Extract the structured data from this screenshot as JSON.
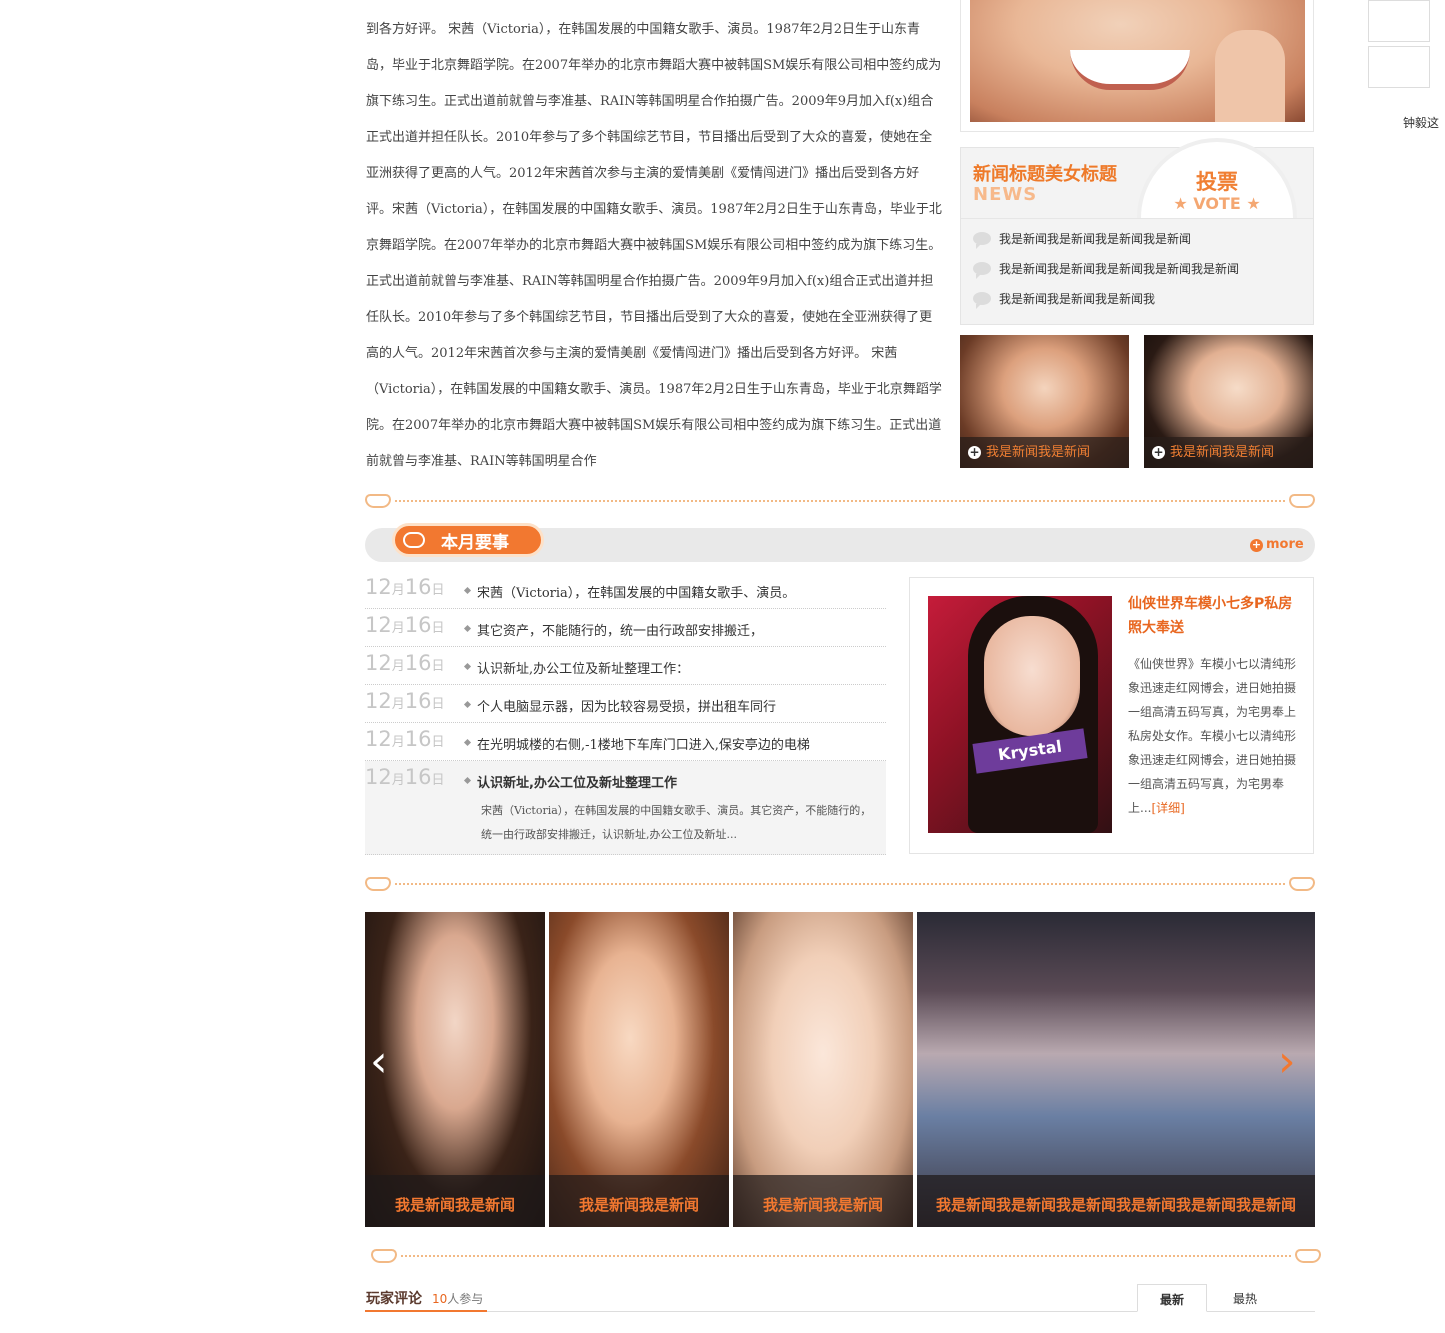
{
  "article": {
    "body": "到各方好评。 宋茜（Victoria），在韩国发展的中国籍女歌手、演员。1987年2月2日生于山东青岛，毕业于北京舞蹈学院。在2007年举办的北京市舞蹈大赛中被韩国SM娱乐有限公司相中签约成为旗下练习生。正式出道前就曾与李准基、RAIN等韩国明星合作拍摄广告。2009年9月加入f(x)组合正式出道并担任队长。2010年参与了多个韩国综艺节目，节目播出后受到了大众的喜爱，使她在全亚洲获得了更高的人气。2012年宋茜首次参与主演的爱情美剧《爱情闯进门》播出后受到各方好评。宋茜（Victoria），在韩国发展的中国籍女歌手、演员。1987年2月2日生于山东青岛，毕业于北京舞蹈学院。在2007年举办的北京市舞蹈大赛中被韩国SM娱乐有限公司相中签约成为旗下练习生。正式出道前就曾与李准基、RAIN等韩国明星合作拍摄广告。2009年9月加入f(x)组合正式出道并担任队长。2010年参与了多个韩国综艺节目，节目播出后受到了大众的喜爱，使她在全亚洲获得了更高的人气。2012年宋茜首次参与主演的爱情美剧《爱情闯进门》播出后受到各方好评。 宋茜（Victoria），在韩国发展的中国籍女歌手、演员。1987年2月2日生于山东青岛，毕业于北京舞蹈学院。在2007年举办的北京市舞蹈大赛中被韩国SM娱乐有限公司相中签约成为旗下练习生。正式出道前就曾与李准基、RAIN等韩国明星合作"
  },
  "vote": {
    "title": "新闻标题美女标题",
    "subtitle": "NEWS",
    "badge_cn": "投票",
    "badge_en": "★ VOTE ★",
    "items": [
      "我是新闻我是新闻我是新闻我是新闻",
      "我是新闻我是新闻我是新闻我是新闻我是新闻",
      "我是新闻我是新闻我是新闻我"
    ]
  },
  "thumbs": [
    "我是新闻我是新闻",
    "我是新闻我是新闻"
  ],
  "section": {
    "title": "本月要事",
    "more": "more"
  },
  "events": [
    {
      "day": "12",
      "month_unit": "月",
      "date": "16",
      "date_unit": "日",
      "text": "宋茜（Victoria），在韩国发展的中国籍女歌手、演员。"
    },
    {
      "day": "12",
      "month_unit": "月",
      "date": "16",
      "date_unit": "日",
      "text": "其它资产，不能随行的，统一由行政部安排搬迁，"
    },
    {
      "day": "12",
      "month_unit": "月",
      "date": "16",
      "date_unit": "日",
      "text": "认识新址,办公工位及新址整理工作："
    },
    {
      "day": "12",
      "month_unit": "月",
      "date": "16",
      "date_unit": "日",
      "text": "个人电脑显示器，因为比较容易受损，拼出租车同行"
    },
    {
      "day": "12",
      "month_unit": "月",
      "date": "16",
      "date_unit": "日",
      "text": "在光明城楼的右侧,-1楼地下车库门口进入,保安亭边的电梯"
    },
    {
      "day": "12",
      "month_unit": "月",
      "date": "16",
      "date_unit": "日",
      "text": "认识新址,办公工位及新址整理工作",
      "desc": "宋茜（Victoria），在韩国发展的中国籍女歌手、演员。其它资产，不能随行的，统一由行政部安排搬迁，认识新址,办公工位及新址..."
    }
  ],
  "feature": {
    "photo_text": "Krystal",
    "title": "仙侠世界车模小七多P私房照大奉送",
    "body": "《仙侠世界》车模小七以清纯形象迅速走红网博会，进日她拍摄一组高清五码写真，为宅男奉上私房处女作。车模小七以清纯形象迅速走红网博会，进日她拍摄一组高清五码写真，为宅男奉上...",
    "link": "[详细]"
  },
  "strip": [
    "我是新闻我是新闻",
    "我是新闻我是新闻",
    "我是新闻我是新闻",
    "我是新闻我是新闻我是新闻我是新闻我是新闻我是新闻"
  ],
  "nav": {
    "prev": "‹",
    "next": "›"
  },
  "comments": {
    "title": "玩家评论",
    "count": "10",
    "count_suffix": "人参与",
    "tab_new": "最新",
    "tab_hot": "最热"
  },
  "gutter": {
    "text": "钟毅这"
  },
  "colors": {
    "accent": "#f27830",
    "title_orange": "#e8661f"
  }
}
